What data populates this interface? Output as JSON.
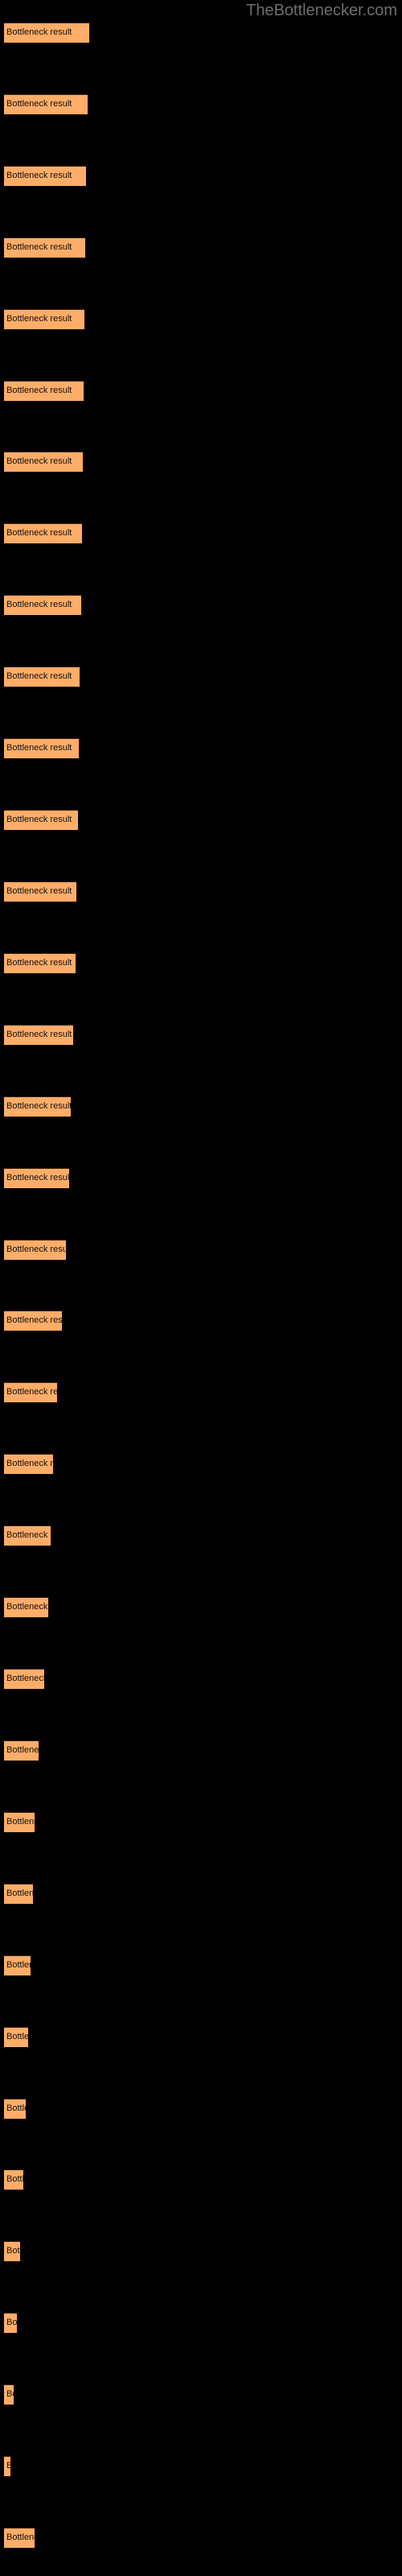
{
  "chart": {
    "title": "TheBottlenecker.com",
    "background_color": "#000000",
    "bar_color": "#ffad68",
    "bar_border_color": "#3a2410",
    "label_color": "#111111",
    "title_color": "#6e6e6e"
  },
  "chart_data": {
    "type": "bar",
    "orientation": "horizontal",
    "title": "TheBottlenecker.com",
    "xlabel": "",
    "ylabel": "",
    "grid": false,
    "legend": null,
    "xlim": [
      0,
      500
    ],
    "categories": [
      "Bottleneck result",
      "Bottleneck result",
      "Bottleneck result",
      "Bottleneck result",
      "Bottleneck result",
      "Bottleneck result",
      "Bottleneck result",
      "Bottleneck result",
      "Bottleneck result",
      "Bottleneck result",
      "Bottleneck result",
      "Bottleneck result",
      "Bottleneck result",
      "Bottleneck result",
      "Bottleneck result",
      "Bottleneck result",
      "Bottleneck result",
      "Bottleneck result",
      "Bottleneck result",
      "Bottleneck result",
      "Bottleneck result",
      "Bottleneck result",
      "Bottleneck result",
      "Bottleneck result",
      "Bottleneck result",
      "Bottleneck result",
      "Bottleneck result",
      "Bottleneck result",
      "Bottleneck result",
      "Bottleneck result",
      "Bottleneck result",
      "Bottleneck result",
      "Bottleneck result",
      "Bottleneck result",
      "Bottleneck result",
      "Bottleneck result"
    ],
    "values": [
      106,
      104,
      102,
      101,
      100,
      99,
      98,
      97,
      96,
      94,
      93,
      92,
      90,
      89,
      86,
      83,
      81,
      77,
      72,
      66,
      61,
      58,
      55,
      50,
      43,
      38,
      36,
      33,
      30,
      27,
      24,
      20,
      16,
      12,
      8,
      38
    ],
    "bars": [
      {
        "label": "Bottleneck result",
        "width": 106,
        "y": 28
      },
      {
        "label": "Bottleneck result",
        "width": 104,
        "y": 71
      },
      {
        "label": "Bottleneck result",
        "width": 102,
        "y": 114
      },
      {
        "label": "Bottleneck result",
        "width": 101,
        "y": 157
      },
      {
        "label": "Bottleneck result",
        "width": 100,
        "y": 200
      },
      {
        "label": "Bottleneck result",
        "width": 99,
        "y": 243
      },
      {
        "label": "Bottleneck result",
        "width": 98,
        "y": 286
      },
      {
        "label": "Bottleneck result",
        "width": 97,
        "y": 329
      },
      {
        "label": "Bottleneck result",
        "width": 96,
        "y": 372
      },
      {
        "label": "Bottleneck result",
        "width": 94,
        "y": 415
      },
      {
        "label": "Bottleneck result",
        "width": 93,
        "y": 458
      },
      {
        "label": "Bottleneck result",
        "width": 92,
        "y": 501
      },
      {
        "label": "Bottleneck result",
        "width": 90,
        "y": 544
      },
      {
        "label": "Bottleneck result",
        "width": 89,
        "y": 588
      },
      {
        "label": "Bottleneck result",
        "width": 86,
        "y": 631
      },
      {
        "label": "Bottleneck result",
        "width": 83,
        "y": 674
      },
      {
        "label": "Bottleneck result",
        "width": 81,
        "y": 717
      },
      {
        "label": "Bottleneck result",
        "width": 77,
        "y": 761
      },
      {
        "label": "Bottleneck result",
        "width": 72,
        "y": 804
      },
      {
        "label": "Bottleneck result",
        "width": 66,
        "y": 847
      },
      {
        "label": "Bottleneck result",
        "width": 61,
        "y": 890
      },
      {
        "label": "Bottleneck result",
        "width": 58,
        "y": 934
      },
      {
        "label": "Bottleneck result",
        "width": 55,
        "y": 977
      },
      {
        "label": "Bottleneck result",
        "width": 50,
        "y": 1020
      },
      {
        "label": "Bottleneck result",
        "width": 43,
        "y": 1063
      },
      {
        "label": "Bottleneck result",
        "width": 38,
        "y": 1107
      },
      {
        "label": "Bottleneck result",
        "width": 36,
        "y": 1150
      },
      {
        "label": "Bottleneck result",
        "width": 33,
        "y": 1193
      },
      {
        "label": "Bottleneck result",
        "width": 30,
        "y": 1236
      },
      {
        "label": "Bottleneck result",
        "width": 27,
        "y": 1280
      },
      {
        "label": "Bottleneck result",
        "width": 24,
        "y": 1323
      },
      {
        "label": "Bottleneck result",
        "width": 20,
        "y": 1366
      },
      {
        "label": "Bottleneck result",
        "width": 16,
        "y": 1409
      },
      {
        "label": "Bottleneck result",
        "width": 12,
        "y": 1453
      },
      {
        "label": "Bottleneck result",
        "width": 8,
        "y": 1496
      },
      {
        "label": "Bottleneck result",
        "width": 38,
        "y": 1539
      }
    ]
  }
}
